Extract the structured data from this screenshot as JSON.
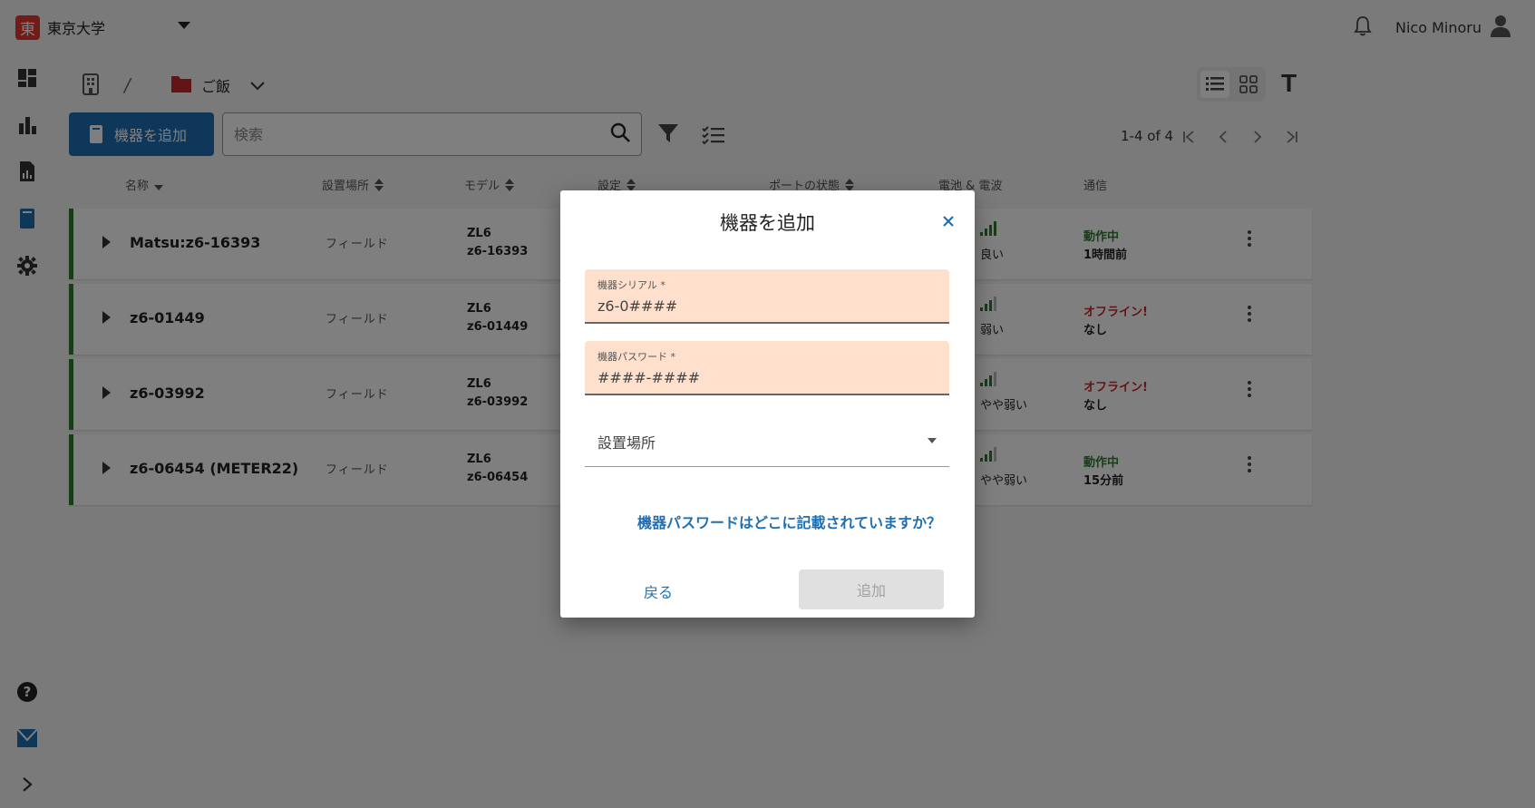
{
  "header": {
    "org_logo_text": "東",
    "org_name": "東京大学",
    "user_name": "Nico Minoru"
  },
  "breadcrumb": {
    "folder_label": "ご飯",
    "separator": "/"
  },
  "toolbar": {
    "add_button_label": "機器を追加",
    "search_placeholder": "検索",
    "pagination_text": "1-4 of 4",
    "text_size_label": "T"
  },
  "table": {
    "headers": [
      "名称",
      "設置場所",
      "モデル",
      "設定",
      "ポートの状態",
      "電池 & 電波",
      "通信"
    ],
    "rows": [
      {
        "name": "Matsu:z6-16393",
        "location": "フィールド",
        "model": "ZL6",
        "serial": "z6-16393",
        "signal": "良い",
        "status": "動作中",
        "status_color": "#2e7d32",
        "last_seen": "1時間前"
      },
      {
        "name": "z6-01449",
        "location": "フィールド",
        "model": "ZL6",
        "serial": "z6-01449",
        "signal": "弱い",
        "status": "オフライン!",
        "status_color": "#c62828",
        "last_seen": "なし"
      },
      {
        "name": "z6-03992",
        "location": "フィールド",
        "model": "ZL6",
        "serial": "z6-03992",
        "signal": "やや弱い",
        "status": "オフライン!",
        "status_color": "#c62828",
        "last_seen": "なし"
      },
      {
        "name": "z6-06454 (METER22)",
        "location": "フィールド",
        "model": "ZL6",
        "serial": "z6-06454",
        "signal": "やや弱い",
        "status": "動作中",
        "status_color": "#2e7d32",
        "last_seen": "15分前"
      }
    ]
  },
  "dialog": {
    "title": "機器を追加",
    "serial_label": "機器シリアル *",
    "serial_value": "z6-0####",
    "password_label": "機器パスワード *",
    "password_value": "####-####",
    "location_label": "設置場所",
    "help_link": "機器パスワードはどこに記載されていますか？",
    "back_label": "戻る",
    "submit_label": "追加"
  },
  "colors": {
    "accent": "#1f6fb2",
    "field_bg": "#ffe0cc",
    "online": "#2e7d32",
    "offline": "#c62828"
  },
  "icons": [
    "dashboard-icon",
    "bar-chart-icon",
    "report-icon",
    "device-icon",
    "gear-icon",
    "help-icon",
    "mail-icon",
    "expand-sidebar-icon",
    "bell-icon",
    "user-icon",
    "building-icon",
    "folder-icon",
    "search-icon",
    "filter-icon",
    "checklist-icon",
    "list-view-icon",
    "grid-view-icon",
    "close-icon",
    "signal-icon"
  ]
}
